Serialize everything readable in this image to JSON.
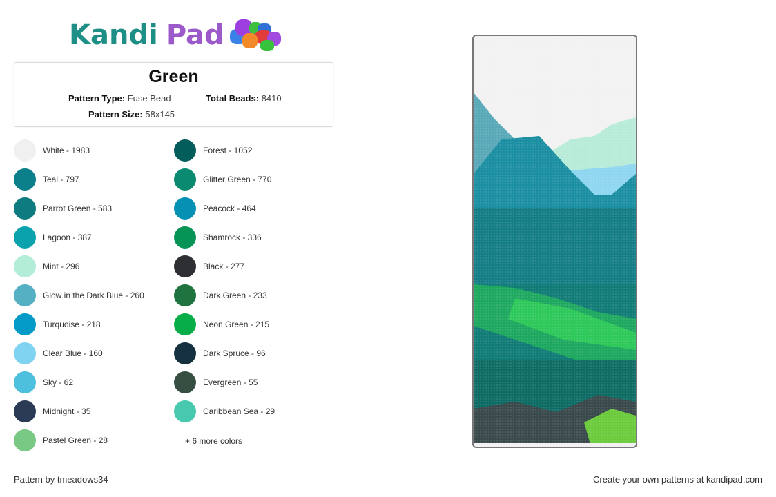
{
  "logo": {
    "part1": "Kandi",
    "part2": "Pad",
    "icon": "beads-icon"
  },
  "pattern": {
    "title": "Green",
    "type_label": "Pattern Type:",
    "type_value": "Fuse Bead",
    "total_label": "Total Beads:",
    "total_value": "8410",
    "size_label": "Pattern Size:",
    "size_value": "58x145"
  },
  "colors_left": [
    {
      "label": "White - 1983",
      "color": "#f0f0f0"
    },
    {
      "label": "Teal - 797",
      "color": "#0b7f8a"
    },
    {
      "label": "Parrot Green - 583",
      "color": "#0d7b80"
    },
    {
      "label": "Lagoon - 387",
      "color": "#0aa3ad"
    },
    {
      "label": "Mint - 296",
      "color": "#b3edd8"
    },
    {
      "label": "Glow in the Dark Blue - 260",
      "color": "#56b0c4"
    },
    {
      "label": "Turquoise - 218",
      "color": "#039ac7"
    },
    {
      "label": "Clear Blue - 160",
      "color": "#80d4f2"
    },
    {
      "label": "Sky - 62",
      "color": "#4cc0dc"
    },
    {
      "label": "Midnight - 35",
      "color": "#2b3a55"
    },
    {
      "label": "Pastel Green - 28",
      "color": "#79c884"
    }
  ],
  "colors_right": [
    {
      "label": "Forest - 1052",
      "color": "#035e5b"
    },
    {
      "label": "Glitter Green - 770",
      "color": "#0b8a72"
    },
    {
      "label": "Peacock - 464",
      "color": "#0591b3"
    },
    {
      "label": "Shamrock - 336",
      "color": "#059356"
    },
    {
      "label": "Black - 277",
      "color": "#2e2f33"
    },
    {
      "label": "Dark Green - 233",
      "color": "#1f733f"
    },
    {
      "label": "Neon Green - 215",
      "color": "#07ae48"
    },
    {
      "label": "Dark Spruce - 96",
      "color": "#15303f"
    },
    {
      "label": "Evergreen - 55",
      "color": "#374f43"
    },
    {
      "label": "Caribbean Sea - 29",
      "color": "#46c9ae"
    }
  ],
  "more_colors": "+ 6 more colors",
  "footer": {
    "author": "Pattern by tmeadows34",
    "promo": "Create your own patterns at kandipad.com"
  }
}
